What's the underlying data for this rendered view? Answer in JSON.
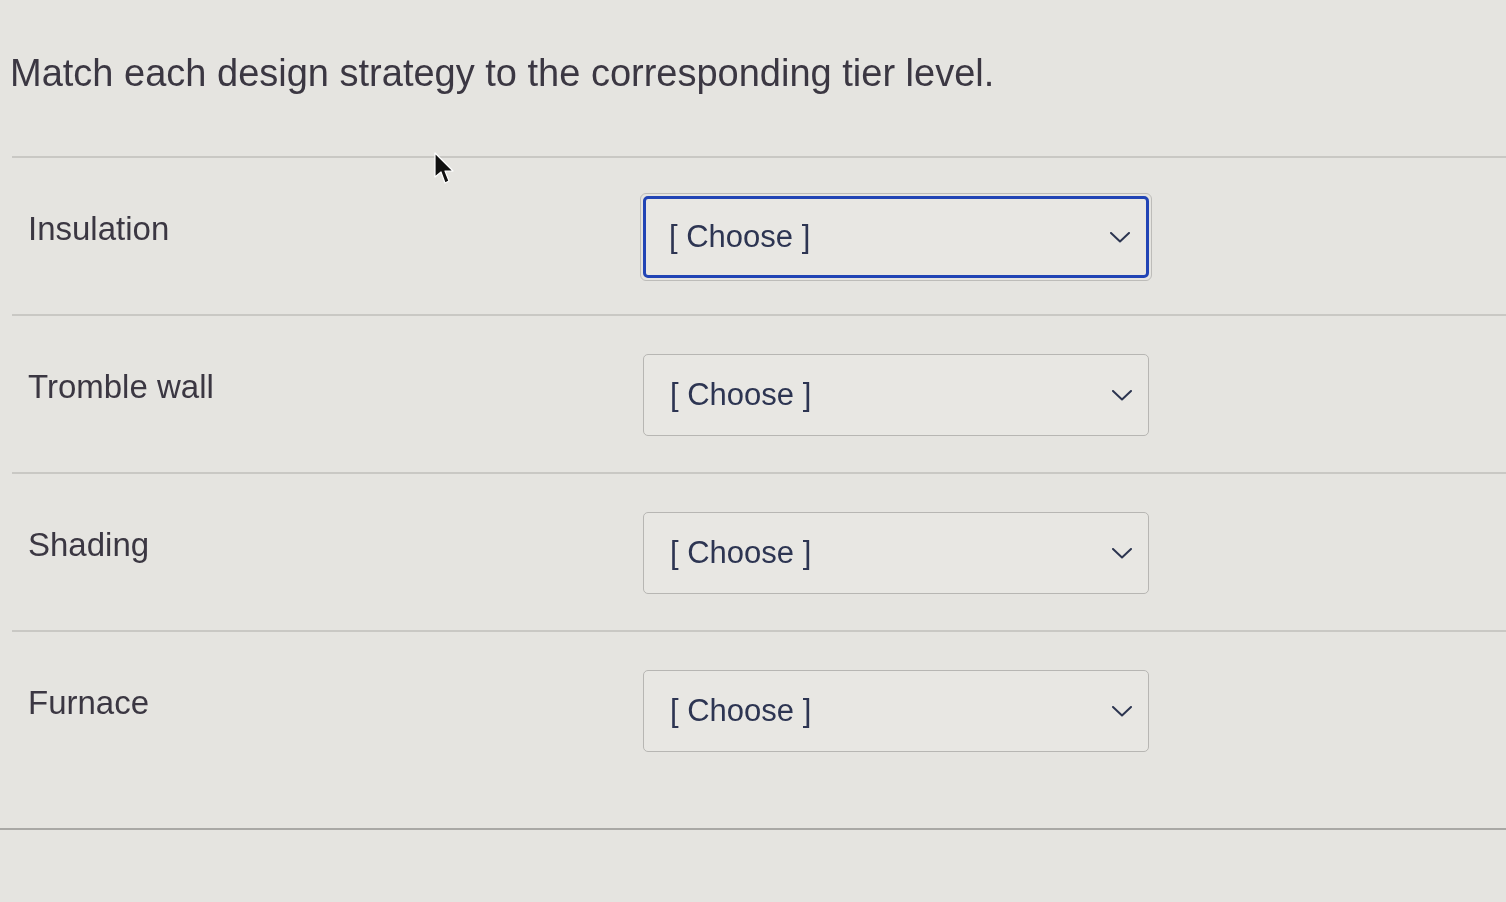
{
  "question": {
    "text": "Match each design strategy to the corresponding tier level."
  },
  "items": [
    {
      "label": "Insulation",
      "select": {
        "value": "[ Choose ]",
        "focused": true
      }
    },
    {
      "label": "Tromble wall",
      "select": {
        "value": "[ Choose ]",
        "focused": false
      }
    },
    {
      "label": "Shading",
      "select": {
        "value": "[ Choose ]",
        "focused": false
      }
    },
    {
      "label": "Furnace",
      "select": {
        "value": "[ Choose ]",
        "focused": false
      }
    }
  ]
}
